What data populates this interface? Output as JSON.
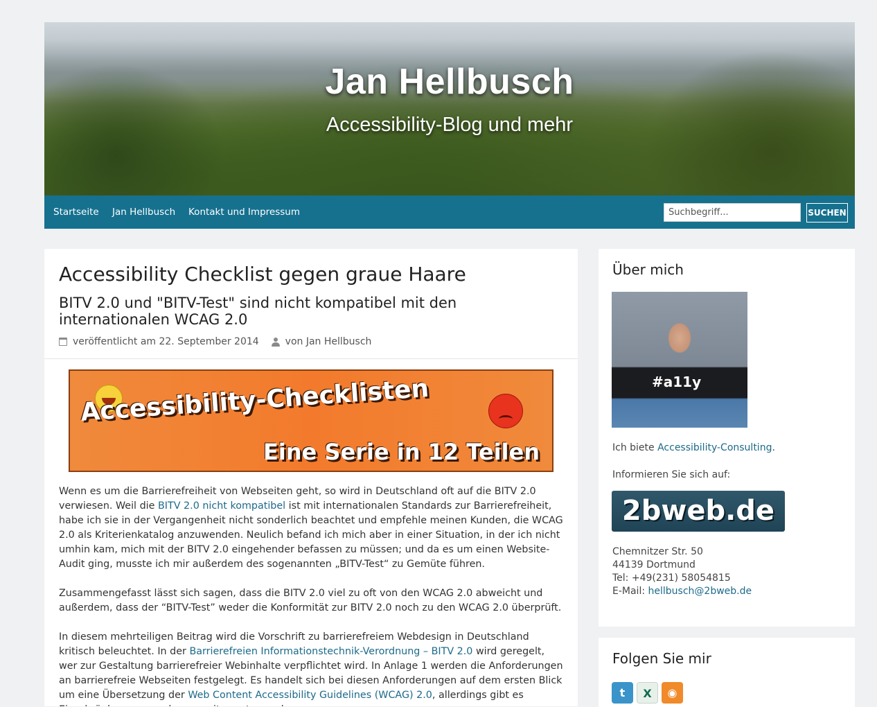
{
  "header": {
    "title": "Jan Hellbusch",
    "tagline": "Accessibility-Blog und mehr"
  },
  "nav": {
    "items": [
      "Startseite",
      "Jan Hellbusch",
      "Kontakt und Impressum"
    ],
    "search_placeholder": "Suchbegriff...",
    "search_button": "SUCHEN"
  },
  "post": {
    "title": "Accessibility Checklist gegen graue Haare",
    "subtitle": "BITV 2.0 und \"BITV-Test\" sind nicht kompatibel mit den internationalen WCAG 2.0",
    "date_label": "veröffentlicht am 22. September 2014",
    "author_label": "von Jan Hellbusch",
    "banner": {
      "line1": "Accessibility-Checklisten",
      "line2": "Eine Serie in 12 Teilen"
    },
    "p1": {
      "t1": "Wenn es um die Barrierefreiheit von Webseiten geht, so wird in Deutschland oft auf die BITV 2.0 verwiesen. Weil die ",
      "link1": "BITV 2.0 nicht kompatibel",
      "t2": " ist mit internationalen Standards zur Barrierefreiheit, habe ich sie in der Vergangenheit nicht sonderlich beachtet und empfehle meinen Kunden, die WCAG 2.0 als Kriterienkatalog anzuwenden. Neulich befand ich mich aber in einer Situation, in der ich nicht umhin kam, mich mit der BITV 2.0 eingehender befassen zu müssen; und da es um einen Website-Audit ging, musste ich mir außerdem des sogenannten „BITV-Test“ zu Gemüte führen."
    },
    "p2": "Zusammengefasst lässt sich sagen, dass die BITV 2.0 viel zu oft von den WCAG 2.0 abweicht und außerdem, dass der “BITV-Test” weder die Konformität zur BITV 2.0 noch zu den WCAG 2.0 überprüft.",
    "p3": {
      "t1": "In diesem mehrteiligen Beitrag wird die Vorschrift zu barrierefreiem Webdesign in Deutschland kritisch beleuchtet. In der ",
      "link1": "Barrierefreien Informationstechnik-Verordnung – BITV 2.0",
      "t2": " wird geregelt, wer zur Gestaltung barrierefreier Webinhalte verpflichtet wird. In Anlage 1 werden die Anforderungen an barrierefreie Webseiten festgelegt. Es handelt sich bei diesen Anforderungen auf dem ersten Blick um eine Übersetzung der ",
      "link2": "Web Content Accessibility Guidelines (WCAG) 2.0",
      "t3": ", allerdings gibt es Einschränkungen, zu denen weiter unten mehr."
    }
  },
  "sidebar": {
    "about": {
      "title": "Über mich",
      "photo_text": "#a11y",
      "offer_text": "Ich biete ",
      "offer_link": "Accessibility-Consulting",
      "offer_end": ".",
      "inform_text": "Informieren Sie sich auf:",
      "logo_text": "2bweb.de",
      "address_street": "Chemnitzer Str. 50",
      "address_city": "44139 Dortmund",
      "phone": "Tel: +49(231) 58054815",
      "email_label": "E-Mail: ",
      "email": "hellbusch@2bweb.de"
    },
    "follow": {
      "title": "Folgen Sie mir",
      "icons": [
        "twitter-icon",
        "xing-icon",
        "rss-icon"
      ]
    }
  },
  "colors": {
    "nav_bg": "#16718f",
    "link": "#1c6a8a",
    "page_bg": "#f0f1f3",
    "banner_orange": "#f37a2c"
  }
}
